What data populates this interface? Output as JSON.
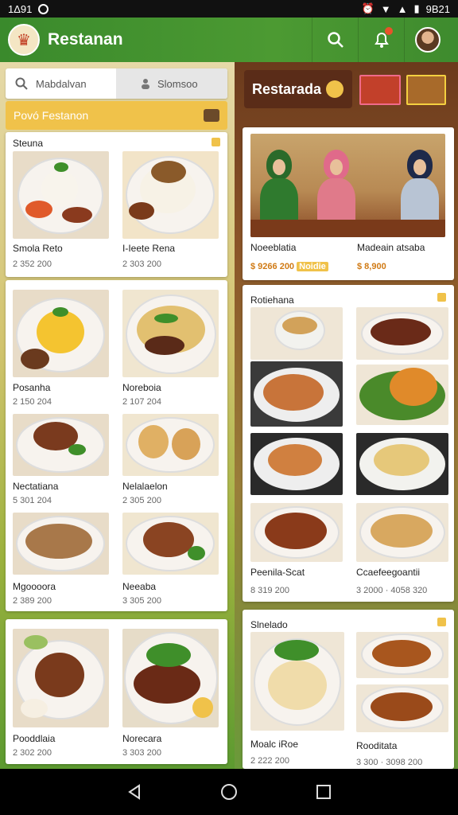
{
  "status": {
    "time": "1Δ91",
    "clock": "9Β21"
  },
  "app": {
    "title": "Restanan"
  },
  "search": {
    "field_text": "Mabdalvan",
    "tab_text": "Slomsoo"
  },
  "section": {
    "label": "Povó Festanon"
  },
  "featured": {
    "title": "Restarada"
  },
  "left_cards": [
    {
      "heading": "Steuna",
      "items": [
        {
          "name": "Smola Reto",
          "price": "2 352 200"
        },
        {
          "name": "I-Ieete Rena",
          "price": "2 303 200"
        }
      ]
    },
    {
      "heading": "",
      "items": [
        {
          "name": "Posanha",
          "price": "2 150 204"
        },
        {
          "name": "Noreboia",
          "price": "2 107 204"
        },
        {
          "name": "Nectatiana",
          "price": "5 301 204"
        },
        {
          "name": "Nelalaelon",
          "price": "2 305 200"
        },
        {
          "name": "Mgoooora",
          "price": "2 389 200"
        },
        {
          "name": "Neeaba",
          "price": "3 305 200"
        }
      ]
    },
    {
      "heading": "",
      "items": [
        {
          "name": "Pooddlaia",
          "price": "2 302 200"
        },
        {
          "name": "Norecara",
          "price": "3 303 200"
        }
      ]
    }
  ],
  "scene_card": {
    "items": [
      {
        "name": "Noeeblatia",
        "price": "$ 9266 200",
        "badge": "Noidie"
      },
      {
        "name": "Madeain atsaba",
        "price": "$ 8,900"
      }
    ]
  },
  "right_card": {
    "heading": "Rotiehana",
    "items": [
      {
        "name": "Peenila-Scat"
      },
      {
        "name": "Ccaefeegoantii"
      }
    ],
    "prices": [
      "8 319 200",
      "3 2000 · 4058 320"
    ]
  },
  "right_card2": {
    "heading": "Slnelado",
    "items": [
      {
        "name": "Moalc iRoe",
        "price": "2 222 200"
      },
      {
        "name": "Rooditata",
        "price": "3 300 · 3098 200"
      }
    ]
  },
  "colors": {
    "brand_green": "#3f8f2e",
    "accent_yellow": "#f0c24a",
    "price_orange": "#d07a14"
  }
}
